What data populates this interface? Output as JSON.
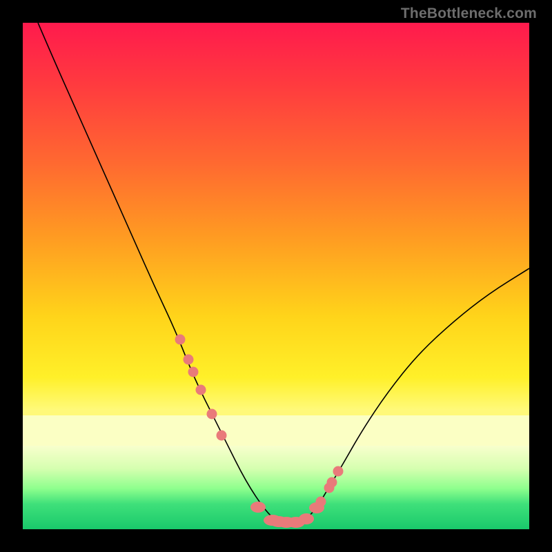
{
  "watermark": "TheBottleneck.com",
  "chart_data": {
    "type": "line",
    "title": "",
    "xlabel": "",
    "ylabel": "",
    "xlim": [
      0,
      100
    ],
    "ylim": [
      0,
      100
    ],
    "series": [
      {
        "name": "curve",
        "x": [
          3,
          6,
          10,
          14,
          18,
          22,
          26,
          30,
          33,
          35,
          37,
          39,
          41,
          43,
          45,
          47,
          49,
          50.5,
          52,
          54,
          56,
          58,
          60,
          63,
          67,
          72,
          78,
          85,
          92,
          100
        ],
        "y": [
          100,
          93,
          84,
          75,
          66,
          57,
          48,
          39.5,
          32,
          27.5,
          23.5,
          19.5,
          15.5,
          11.5,
          8,
          5,
          2.5,
          1.7,
          1.3,
          1.3,
          2,
          4.2,
          7.5,
          12.5,
          19.5,
          27,
          34.5,
          41,
          46.5,
          51.5
        ]
      }
    ],
    "markers": {
      "name": "highlighted-points",
      "color": "#e97a7a",
      "x": [
        31.0,
        32.7,
        33.7,
        35.2,
        37.3,
        39.3,
        46.5,
        49.3,
        50.5,
        52.0,
        54.0,
        56.0,
        58.0,
        58.9,
        60.5,
        61.0,
        62.2
      ],
      "y": [
        37.5,
        33.5,
        31.0,
        27.5,
        22.8,
        18.5,
        4.3,
        1.8,
        1.5,
        1.3,
        1.4,
        2.0,
        4.2,
        5.5,
        8.2,
        9.3,
        11.5
      ]
    },
    "background": {
      "type": "vertical-gradient",
      "stops": [
        {
          "pos": 0.0,
          "color": "#ff1a4d"
        },
        {
          "pos": 0.58,
          "color": "#ffd41a"
        },
        {
          "pos": 0.78,
          "color": "#fffc8d"
        },
        {
          "pos": 1.0,
          "color": "#19c96b"
        }
      ],
      "highlight_band": {
        "from_y_pct": 77.5,
        "to_y_pct": 83.5,
        "color": "#fbffc4"
      }
    }
  }
}
